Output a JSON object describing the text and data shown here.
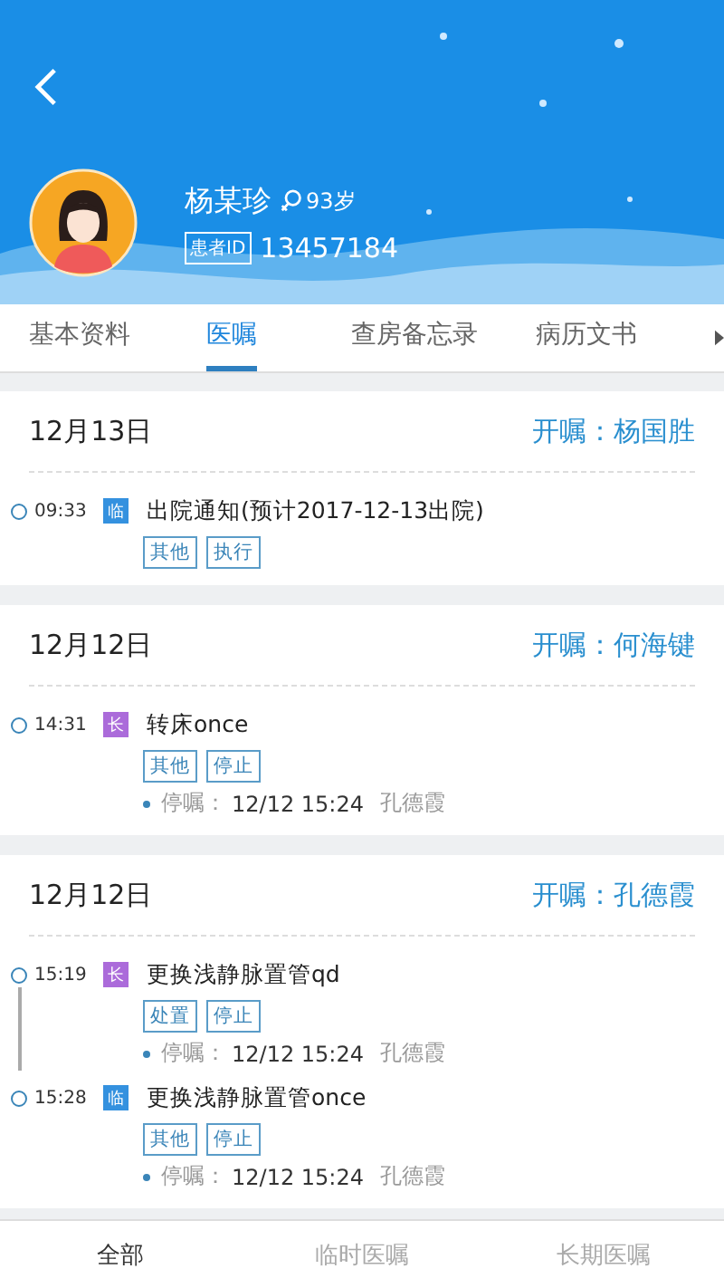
{
  "patient": {
    "name": "杨某珍",
    "age": "93岁",
    "id_label": "患者ID",
    "id": "13457184"
  },
  "tabs": [
    {
      "label": "基本资料",
      "selected": false
    },
    {
      "label": "医嘱",
      "selected": true
    },
    {
      "label": "查房备忘录",
      "selected": false
    },
    {
      "label": "病历文书",
      "selected": false
    }
  ],
  "sections": [
    {
      "date": "12月13日",
      "doctor": "开嘱：杨国胜",
      "items": [
        {
          "time": "09:33",
          "badge": "临",
          "kind": "temporary",
          "title": "出院通知(预计2017-12-13出院)",
          "tags": [
            "其他",
            "执行"
          ]
        }
      ]
    },
    {
      "date": "12月12日",
      "doctor": "开嘱：何海键",
      "items": [
        {
          "time": "14:31",
          "badge": "长",
          "kind": "long_term",
          "title": "转床once",
          "tags": [
            "其他",
            "停止"
          ],
          "stop_label": "停嘱：",
          "stop_time": "12/12 15:24",
          "stop_by": "孔德霞"
        }
      ]
    },
    {
      "date": "12月12日",
      "doctor": "开嘱：孔德霞",
      "items": [
        {
          "time": "15:19",
          "badge": "长",
          "kind": "long_term",
          "title": "更换浅静脉置管qd",
          "tags": [
            "处置",
            "停止"
          ],
          "stop_label": "停嘱：",
          "stop_time": "12/12 15:24",
          "stop_by": "孔德霞"
        },
        {
          "time": "15:28",
          "badge": "临",
          "kind": "temporary",
          "title": "更换浅静脉置管once",
          "tags": [
            "其他",
            "停止"
          ],
          "stop_label": "停嘱：",
          "stop_time": "12/12 15:24",
          "stop_by": "孔德霞"
        }
      ]
    }
  ],
  "bottom_tabs": [
    {
      "label": "全部",
      "selected": true
    },
    {
      "label": "临时医嘱",
      "selected": false
    },
    {
      "label": "长期医嘱",
      "selected": false
    }
  ]
}
